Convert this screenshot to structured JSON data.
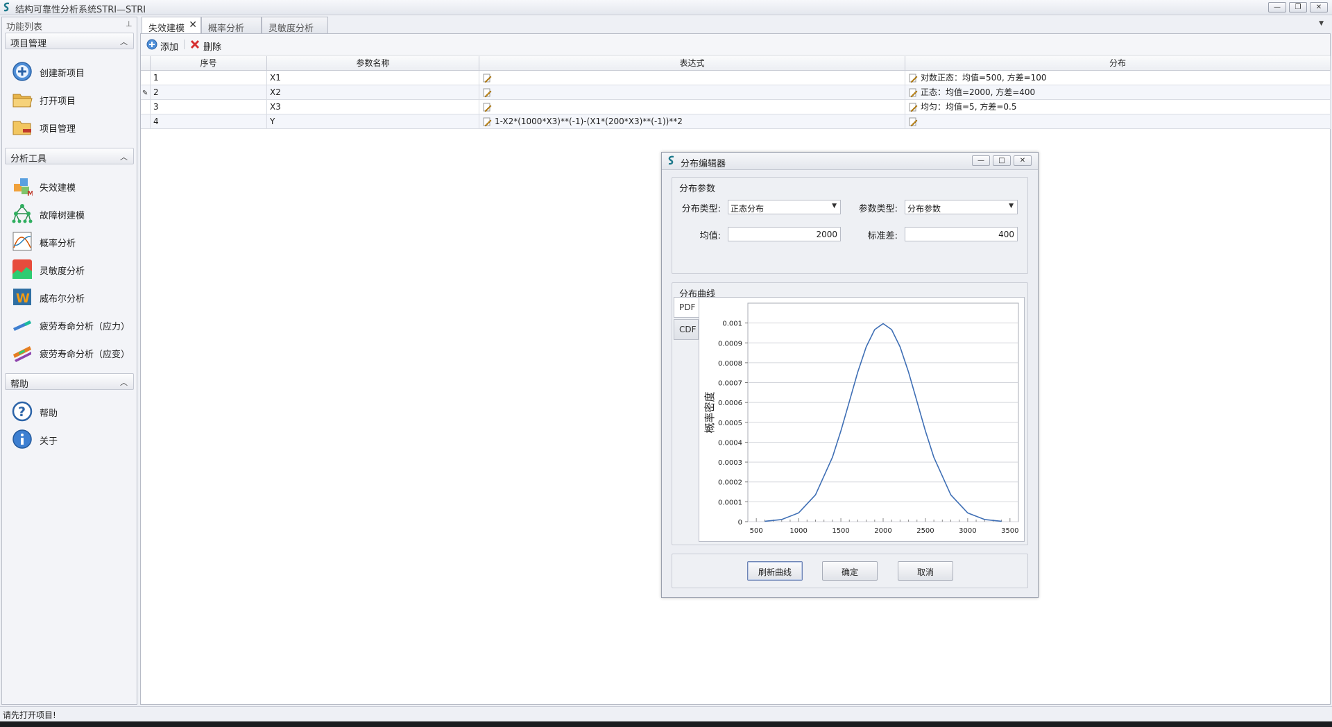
{
  "window": {
    "title": "结构可靠性分析系统STRI—STRI",
    "controls": [
      "minimize",
      "restore",
      "close"
    ]
  },
  "sidebar": {
    "panel_title": "功能列表",
    "pin_icon": "pin-icon",
    "groups": [
      {
        "label": "项目管理",
        "items": [
          {
            "label": "创建新项目",
            "icon": "add-circle-icon"
          },
          {
            "label": "打开项目",
            "icon": "open-folder-icon"
          },
          {
            "label": "项目管理",
            "icon": "folder-manage-icon"
          }
        ]
      },
      {
        "label": "分析工具",
        "items": [
          {
            "label": "失效建模",
            "icon": "cubes-model-icon"
          },
          {
            "label": "故障树建模",
            "icon": "fault-tree-icon"
          },
          {
            "label": "概率分析",
            "icon": "probability-chart-icon"
          },
          {
            "label": "灵敏度分析",
            "icon": "sensitivity-chart-icon"
          },
          {
            "label": "威布尔分析",
            "icon": "weibull-icon"
          },
          {
            "label": "疲劳寿命分析（应力）",
            "icon": "stress-beam-icon"
          },
          {
            "label": "疲劳寿命分析（应变）",
            "icon": "strain-beam-icon"
          }
        ]
      },
      {
        "label": "帮助",
        "items": [
          {
            "label": "帮助",
            "icon": "help-icon"
          },
          {
            "label": "关于",
            "icon": "info-icon"
          }
        ]
      }
    ]
  },
  "tabs": [
    {
      "label": "失效建模",
      "active": true,
      "closable": true
    },
    {
      "label": "概率分析",
      "active": false
    },
    {
      "label": "灵敏度分析",
      "active": false
    }
  ],
  "toolbar": {
    "add_label": "添加",
    "delete_label": "删除"
  },
  "grid": {
    "columns": [
      "序号",
      "参数名称",
      "表达式",
      "分布"
    ],
    "rows": [
      {
        "index": "1",
        "name": "X1",
        "expression": "",
        "distribution": "对数正态：均值=500, 方差=100"
      },
      {
        "index": "2",
        "name": "X2",
        "expression": "",
        "distribution": "正态：均值=2000, 方差=400",
        "editing": true
      },
      {
        "index": "3",
        "name": "X3",
        "expression": "",
        "distribution": "均匀：均值=5, 方差=0.5"
      },
      {
        "index": "4",
        "name": "Y",
        "expression": "1-X2*(1000*X3)**(-1)-(X1*(200*X3)**(-1))**2",
        "distribution": ""
      }
    ]
  },
  "dialog": {
    "title": "分布编辑器",
    "params_group": "分布参数",
    "dist_type_label": "分布类型:",
    "dist_type_value": "正态分布",
    "param_type_label": "参数类型:",
    "param_type_value": "分布参数",
    "mean_label": "均值:",
    "mean_value": "2000",
    "std_label": "标准差:",
    "std_value": "400",
    "curve_group": "分布曲线",
    "curve_tabs": [
      "PDF",
      "CDF"
    ],
    "buttons": {
      "refresh": "刷新曲线",
      "ok": "确定",
      "cancel": "取消"
    }
  },
  "chart_data": {
    "type": "line",
    "ylabel": "概率密度",
    "xlabel": "",
    "xlim": [
      400,
      3600
    ],
    "ylim": [
      0,
      0.0011
    ],
    "x_ticks": [
      "500",
      "1000",
      "1500",
      "2000",
      "2500",
      "3000",
      "3500"
    ],
    "x_tick_values": [
      500,
      1000,
      1500,
      2000,
      2500,
      3000,
      3500
    ],
    "y_ticks": [
      "0",
      "0.0001",
      "0.0002",
      "0.0003",
      "0.0004",
      "0.0005",
      "0.0006",
      "0.0007",
      "0.0008",
      "0.0009",
      "0.001"
    ],
    "y_tick_values": [
      0,
      0.0001,
      0.0002,
      0.0003,
      0.0004,
      0.0005,
      0.0006,
      0.0007,
      0.0008,
      0.0009,
      0.001
    ],
    "grid": true,
    "series": [
      {
        "color": "#3f6fb5",
        "x": [
          600,
          800,
          1000,
          1200,
          1400,
          1500,
          1600,
          1700,
          1800,
          1900,
          2000,
          2100,
          2200,
          2300,
          2400,
          2500,
          2600,
          2800,
          3000,
          3200,
          3400
        ],
        "y": [
          2.2e-06,
          1.1e-05,
          4.4e-05,
          0.000135,
          0.000324,
          0.000457,
          0.000605,
          0.000753,
          0.00088,
          0.000967,
          0.000997,
          0.000967,
          0.00088,
          0.000753,
          0.000605,
          0.000457,
          0.000324,
          0.000135,
          4.4e-05,
          1.1e-05,
          2.2e-06
        ]
      }
    ]
  },
  "statusbar": {
    "text": "请先打开项目!"
  },
  "colors": {
    "accent": "#3f6fb5",
    "window_bg": "#eef0f5"
  }
}
